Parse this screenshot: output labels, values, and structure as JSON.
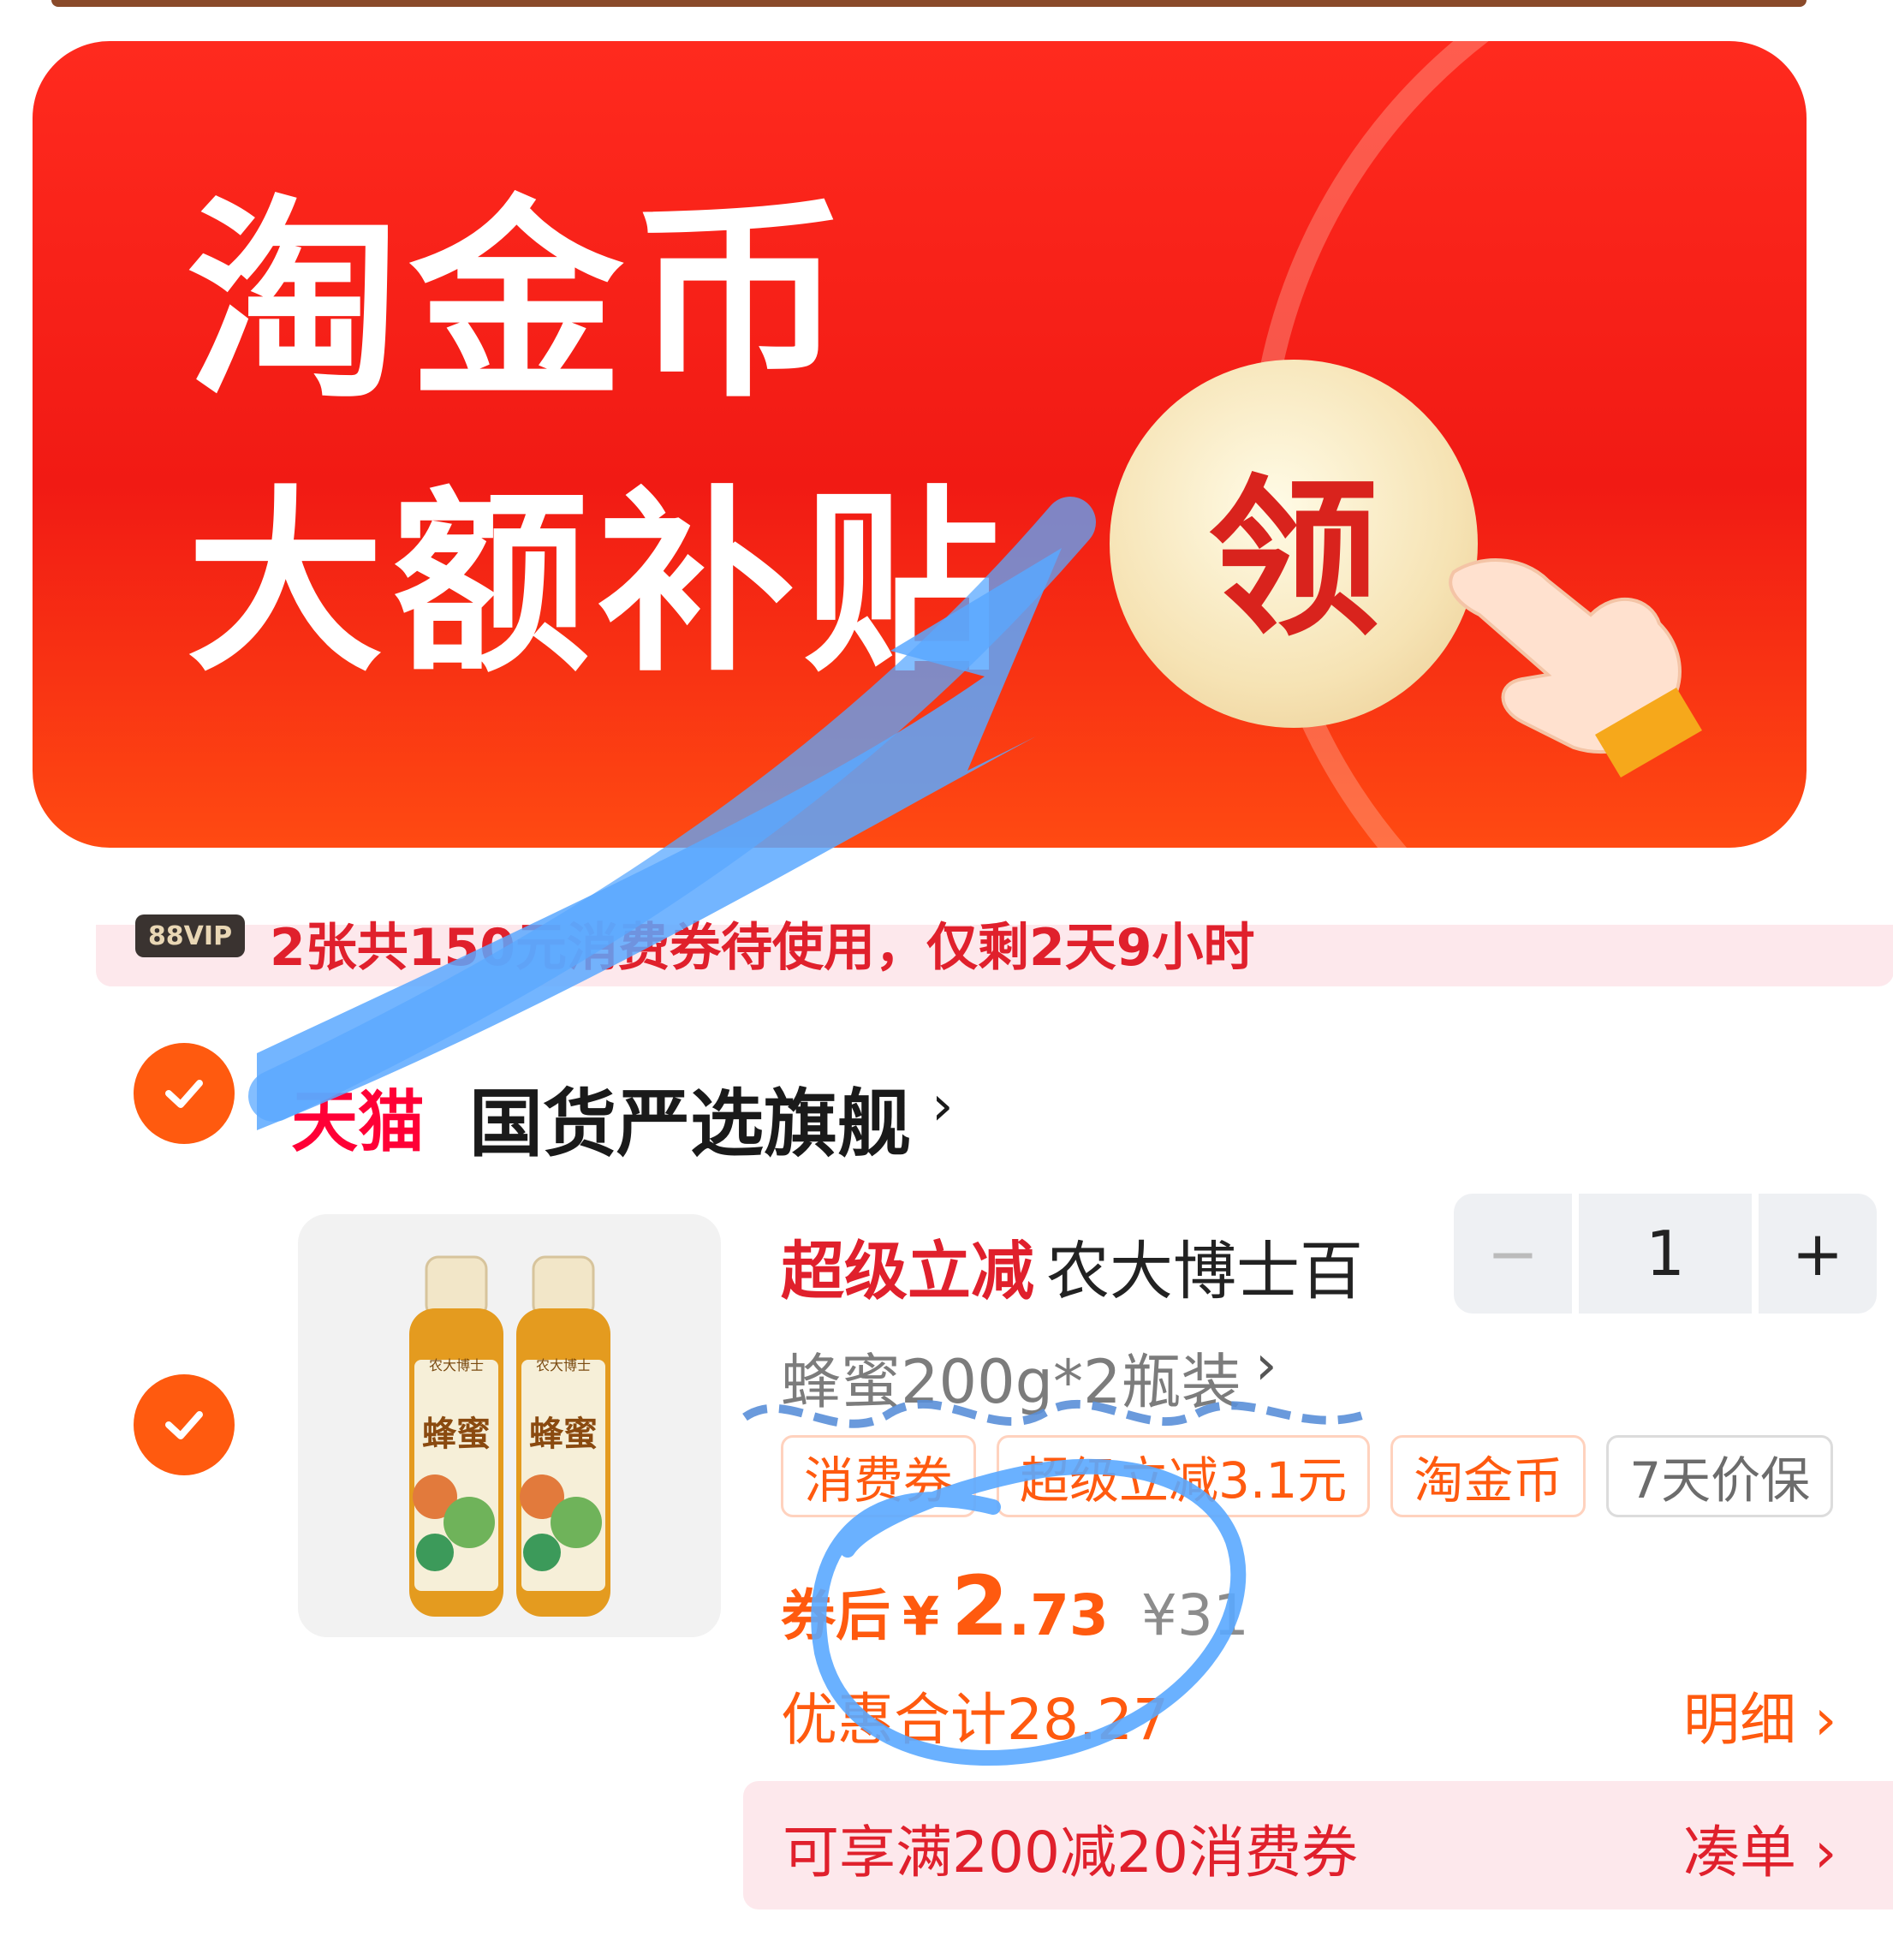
{
  "banner": {
    "title_line1": "淘金币",
    "title_line2": "大额补贴",
    "claim_button": "领",
    "colors": {
      "background": "#f11a14",
      "claim": "#f6e3b4"
    }
  },
  "voucher_strip": {
    "badge": "88VIP",
    "text": "2张共150元消费券待使用，仅剩2天9小时"
  },
  "store": {
    "logo": "天猫",
    "name": "国货严选旗舰",
    "chevron": "›"
  },
  "product": {
    "title_prefix": "超级立减",
    "title": "农大博士百",
    "spec": "蜂蜜200g*2瓶装",
    "spec_chevron": "›",
    "image_alt": "蜂蜜",
    "bottle_label_top": "农大博士",
    "bottle_label_main": "蜂蜜",
    "quantity": {
      "minus": "−",
      "value": "1",
      "plus": "+"
    },
    "tags": [
      {
        "label": "消费券",
        "style": "orange"
      },
      {
        "label": "超级立减3.1元",
        "style": "orange"
      },
      {
        "label": "淘金币",
        "style": "orange"
      },
      {
        "label": "7天价保",
        "style": "gray"
      }
    ],
    "price": {
      "prefix": "券后",
      "currency": "¥",
      "integer": "2",
      "decimal": ".73",
      "original": "¥31"
    },
    "saving": "优惠合计28.27",
    "detail_link": "明细 ›"
  },
  "promo_bar": {
    "text": "可享满200减20消费券",
    "link": "凑单 ›"
  },
  "colors": {
    "accent_orange": "#ff5a0f",
    "accent_red": "#e0202c",
    "annotation_blue": "#5aa8ff"
  }
}
